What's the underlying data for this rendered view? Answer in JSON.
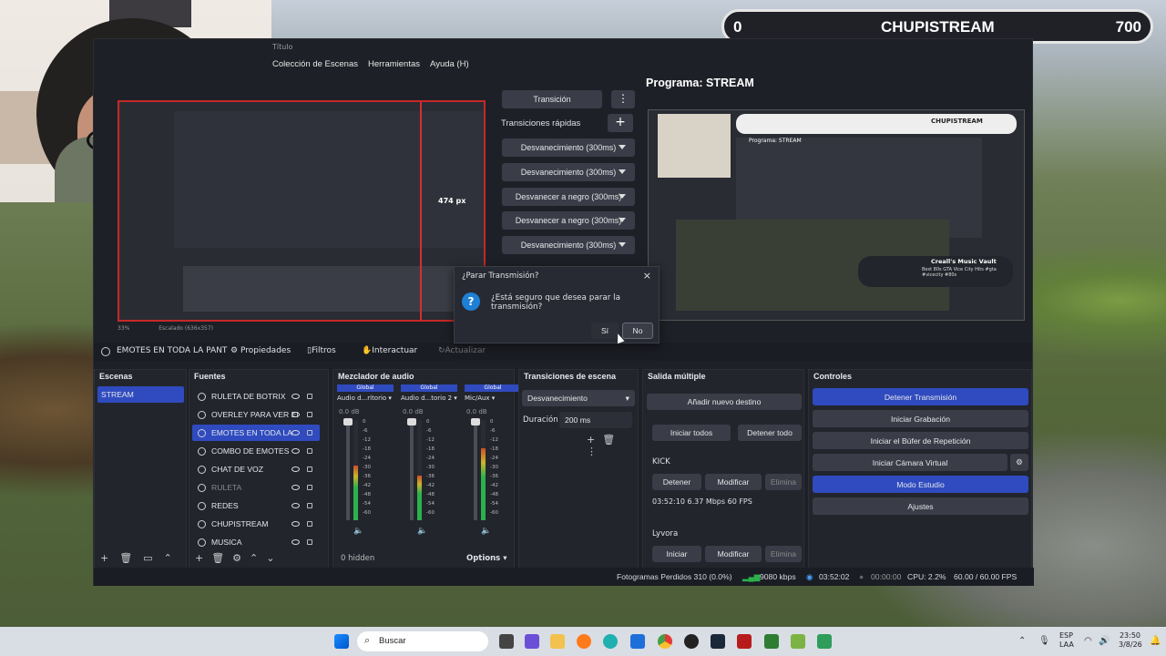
{
  "overlay": {
    "left_num": "0",
    "name": "CHUPISTREAM",
    "right_num": "700"
  },
  "window": {
    "title": "Título"
  },
  "menu": [
    "Colección de Escenas",
    "Herramientas",
    "Ayuda (H)"
  ],
  "preview": {
    "scale_text": "33%",
    "scaled_label": "Escalado (636x357)",
    "size_text": "474 px"
  },
  "program": {
    "title": "Programa: STREAM",
    "inner_title": "Programa: STREAM",
    "music_title": "Creall's Music Vault",
    "music_sub": "Best 80s GTA Vice City Hits #gta #vicecity #80s"
  },
  "transitions": {
    "transition_btn": "Transición",
    "quick_label": "Transiciones rápidas",
    "items": [
      "Desvanecimiento (300ms)",
      "Desvanecimiento (300ms)",
      "Desvanecer a negro (300ms)",
      "Desvanecer a negro (300ms)",
      "Desvanecimiento (300ms)"
    ]
  },
  "dialog": {
    "title": "¿Parar Transmisión?",
    "message": "¿Está seguro que desea parar la transmisión?",
    "yes": "Sí",
    "no": "No"
  },
  "source_toolbar": {
    "source": "EMOTES EN TODA LA PANT",
    "properties": "Propiedades",
    "filters": "Filtros",
    "interact": "Interactuar",
    "refresh": "Actualizar"
  },
  "scenes": {
    "title": "Escenas",
    "items": [
      "STREAM"
    ]
  },
  "sources": {
    "title": "Fuentes",
    "items": [
      {
        "label": "RULETA DE BOTRIX",
        "visible": true
      },
      {
        "label": "OVERLEY PARA VER EI",
        "visible": true
      },
      {
        "label": "EMOTES EN TODA LA",
        "visible": true
      },
      {
        "label": "COMBO DE EMOTES",
        "visible": true
      },
      {
        "label": "CHAT DE VOZ",
        "visible": true
      },
      {
        "label": "RULETA",
        "visible": false
      },
      {
        "label": "REDES",
        "visible": true
      },
      {
        "label": "CHUPISTREAM",
        "visible": true
      },
      {
        "label": "MUSICA",
        "visible": true
      }
    ]
  },
  "mixer": {
    "title": "Mezclador de audio",
    "channels": [
      {
        "global": "Global",
        "name": "Audio d...ritorio",
        "db": "0.0 dB",
        "level": 0.55
      },
      {
        "global": "Global",
        "name": "Audio d...torio 2",
        "db": "0.0 dB",
        "level": 0.45
      },
      {
        "global": "Global",
        "name": "Mic/Aux",
        "db": "0.0 dB",
        "level": 0.72
      }
    ],
    "scale": [
      "0",
      "-6",
      "-12",
      "-18",
      "-24",
      "-30",
      "-36",
      "-42",
      "-48",
      "-54",
      "-60"
    ],
    "hidden": "0 hidden",
    "options": "Options"
  },
  "scene_transitions": {
    "title": "Transiciones de escena",
    "selected": "Desvanecimiento",
    "duration_label": "Duración",
    "duration": "200 ms"
  },
  "multi_output": {
    "title": "Salida múltiple",
    "add": "Añadir nuevo destino",
    "start_all": "Iniciar todos",
    "stop_all": "Detener todo",
    "targets": [
      {
        "name": "KICK",
        "b1": "Detener",
        "b2": "Modificar",
        "b3": "Elimina",
        "stats": "03:52:10  6.37 Mbps  60 FPS"
      },
      {
        "name": "Lyvora",
        "b1": "Iniciar",
        "b2": "Modificar",
        "b3": "Elimina"
      }
    ]
  },
  "controls": {
    "title": "Controles",
    "buttons": [
      "Detener Transmisión",
      "Iniciar Grabación",
      "Iniciar el Búfer de Repetición",
      "Iniciar Cámara Virtual",
      "Modo Estudio",
      "Ajustes"
    ]
  },
  "status": {
    "dropped": "Fotogramas Perdidos 310 (0.0%)",
    "kbps": "9080 kbps",
    "live": "03:52:02",
    "rec": "00:00:00",
    "cpu": "CPU: 2.2%",
    "fps": "60.00 / 60.00 FPS"
  },
  "taskbar": {
    "search": "Buscar",
    "lang1": "ESP",
    "lang2": "LAA",
    "time": "23:50",
    "date": "3/8/26"
  }
}
